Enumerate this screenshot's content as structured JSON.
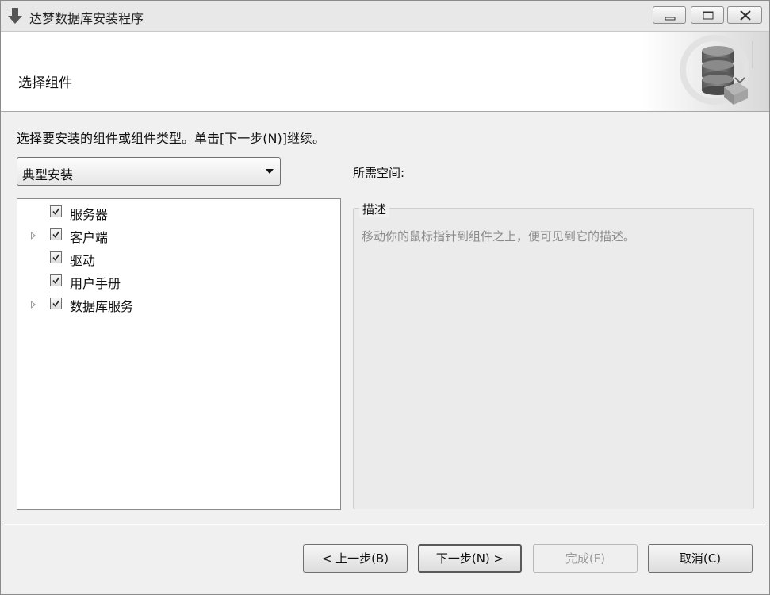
{
  "window": {
    "title": "达梦数据库安装程序",
    "controls": [
      "minimize-icon",
      "maximize-icon",
      "close-icon"
    ]
  },
  "header": {
    "title": "选择组件",
    "art_icon": "database-icon"
  },
  "instruction": "选择要安装的组件或组件类型。单击[下一步(N)]继续。",
  "install_type": {
    "selected": "典型安装"
  },
  "space": {
    "label": "所需空间:"
  },
  "components": [
    {
      "label": "服务器",
      "checked": true,
      "expandable": false
    },
    {
      "label": "客户端",
      "checked": true,
      "expandable": true
    },
    {
      "label": "驱动",
      "checked": true,
      "expandable": false
    },
    {
      "label": "用户手册",
      "checked": true,
      "expandable": false
    },
    {
      "label": "数据库服务",
      "checked": true,
      "expandable": true
    }
  ],
  "description": {
    "title": "描述",
    "text": "移动你的鼠标指针到组件之上，便可见到它的描述。"
  },
  "buttons": {
    "back": "< 上一步(B)",
    "next": "下一步(N) >",
    "finish": "完成(F)",
    "cancel": "取消(C)"
  },
  "colors": {
    "dialog_bg": "#f0f0f0",
    "header_bg": "#ffffff",
    "disabled_text": "#9a9a9a",
    "hint_text": "#8c8c8c"
  }
}
